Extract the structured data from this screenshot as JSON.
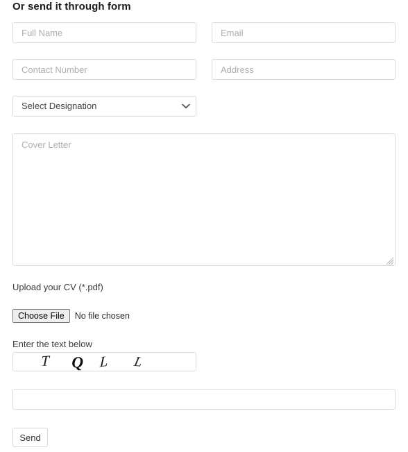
{
  "form": {
    "heading": "Or send it through form",
    "fields": {
      "full_name": {
        "placeholder": "Full Name",
        "value": ""
      },
      "email": {
        "placeholder": "Email",
        "value": ""
      },
      "contact_number": {
        "placeholder": "Contact Number",
        "value": ""
      },
      "address": {
        "placeholder": "Address",
        "value": ""
      },
      "designation": {
        "selected": "Select Designation",
        "options": [
          "Select Designation"
        ]
      },
      "cover_letter": {
        "placeholder": "Cover Letter",
        "value": ""
      },
      "captcha_answer": {
        "placeholder": "",
        "value": ""
      }
    },
    "upload": {
      "label": "Upload your CV (*.pdf)",
      "button_label": "Choose File",
      "status": "No file chosen"
    },
    "captcha": {
      "label": "Enter the text below",
      "text": "TQLL",
      "characters": [
        "T",
        "Q",
        "L",
        "L"
      ]
    },
    "submit": {
      "label": "Send"
    },
    "icons": {
      "select_arrow": "chevron-down-icon",
      "resize_grip": "resize-grip-icon"
    },
    "colors": {
      "page_background": "#ffffff",
      "field_border": "#dcdcdc",
      "placeholder_text": "#adadad",
      "heading_text": "#1b1b1b",
      "body_text": "#333333",
      "file_button_background": "#efefef",
      "file_button_border": "#767676",
      "captcha_text": "#111111"
    }
  }
}
